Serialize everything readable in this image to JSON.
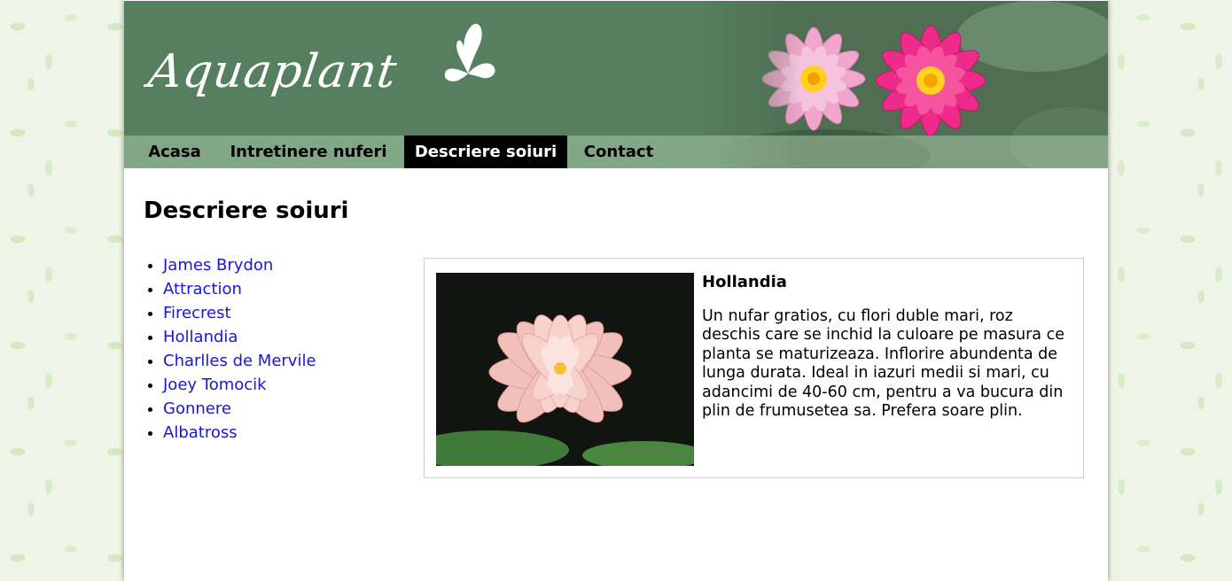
{
  "site": {
    "logo_text": "Aquaplant"
  },
  "nav": {
    "items": [
      {
        "label": "Acasa",
        "active": false
      },
      {
        "label": "Intretinere nuferi",
        "active": false
      },
      {
        "label": "Descriere soiuri",
        "active": true
      },
      {
        "label": "Contact",
        "active": false
      }
    ]
  },
  "main": {
    "title": "Descriere soiuri",
    "varieties": [
      "James Brydon",
      "Attraction",
      "Firecrest",
      "Hollandia",
      "Charlles de Mervile",
      "Joey Tomocik",
      "Gonnere",
      "Albatross"
    ],
    "detail": {
      "name": "Hollandia",
      "description": "Un nufar gratios, cu flori duble mari, roz deschis care se inchid la culoare pe masura ce planta se maturizeaza. Inflorire abundenta de lunga durata. Ideal in iazuri medii si mari, cu adancimi de 40-60 cm, pentru a va bucura din plin de frumusetea sa. Prefera soare plin."
    }
  },
  "colors": {
    "header_green": "#557f5e",
    "nav_active_bg": "#000000",
    "link_blue": "#1717d4"
  },
  "icons": [
    "butterfly-icon",
    "water-lily-image",
    "list-bullet"
  ]
}
